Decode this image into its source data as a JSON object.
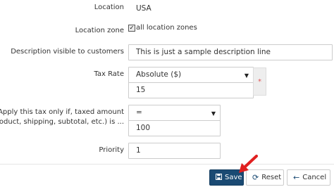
{
  "form": {
    "location": {
      "label": "Location",
      "value": "USA"
    },
    "location_zone": {
      "label": "Location zone",
      "checked": true,
      "checkbox_label": "all location zones"
    },
    "description": {
      "label": "Description visible to customers",
      "value": "This is just a sample description line"
    },
    "tax_rate": {
      "label": "Tax Rate",
      "type_value": "Absolute ($)",
      "amount": "15",
      "required_marker": "*"
    },
    "condition": {
      "label_line1": "Apply this tax only if, taxed amount",
      "label_line2": "(product, shipping, subtotal, etc.) is ...",
      "operator": "=",
      "amount": "100"
    },
    "priority": {
      "label": "Priority",
      "value": "1"
    }
  },
  "actions": {
    "save": "Save",
    "reset": "Reset",
    "cancel": "Cancel"
  },
  "icons": {
    "save": "floppy-disk-icon",
    "reset": "refresh-icon",
    "cancel": "arrow-left-icon",
    "caret": "caret-down-icon",
    "pointer": "red-arrow-icon"
  },
  "colors": {
    "save_button": "#1a4a73",
    "required_marker": "#e05555",
    "pointer_arrow": "#e02020"
  }
}
